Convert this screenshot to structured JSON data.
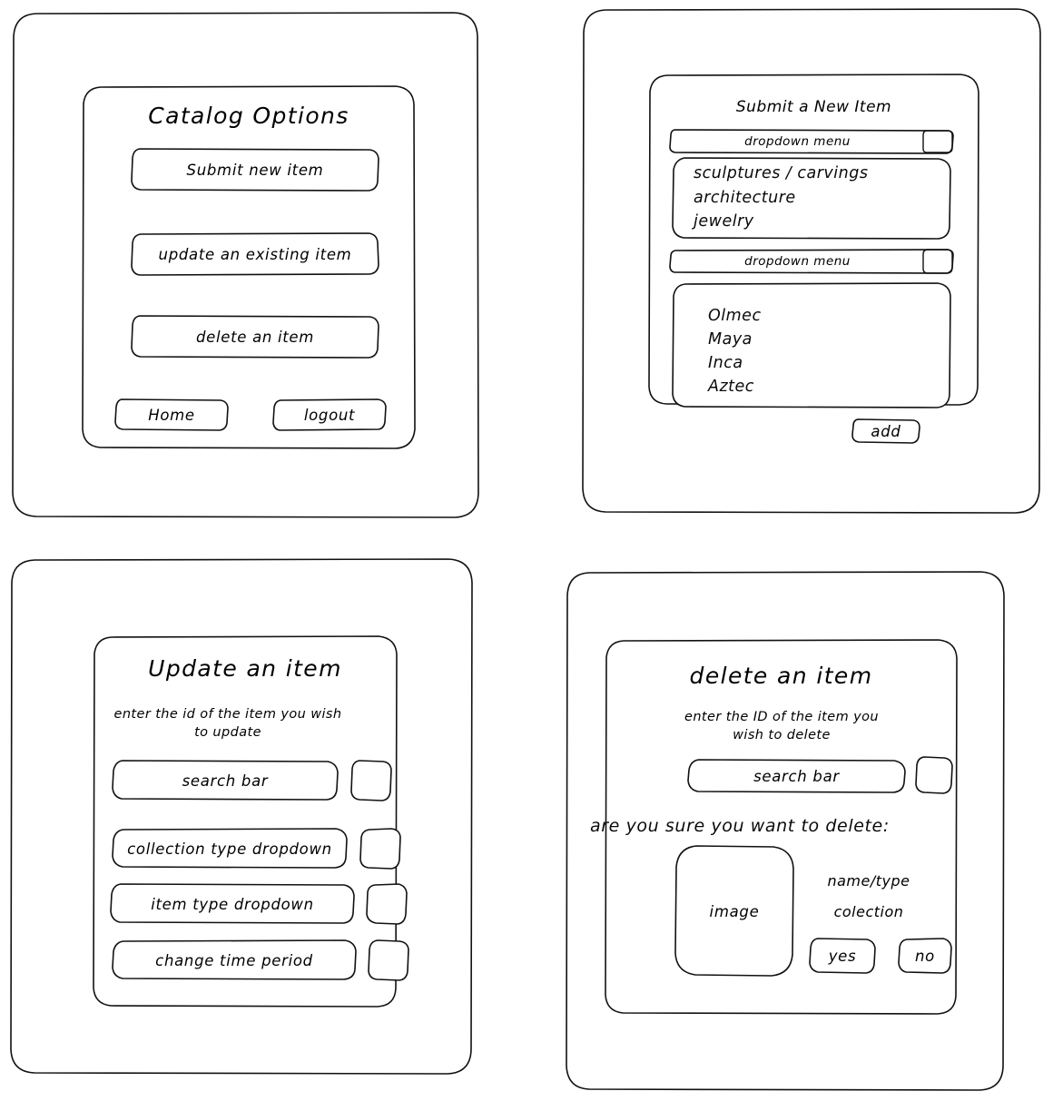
{
  "wireframe": {
    "stroke_color": "#111111",
    "background_color": "#ffffff",
    "panels": [
      {
        "id": "catalog-options",
        "title": "Catalog Options",
        "buttons": [
          {
            "label": "Submit new item"
          },
          {
            "label": "update an existing item"
          },
          {
            "label": "delete an item"
          }
        ],
        "footer_buttons": [
          {
            "label": "Home"
          },
          {
            "label": "logout"
          }
        ]
      },
      {
        "id": "submit-new-item",
        "title": "Submit a New Item",
        "dropdowns": [
          {
            "label": "dropdown menu",
            "options": [
              "sculptures / carvings",
              "architecture",
              "jewelry"
            ]
          },
          {
            "label": "dropdown menu",
            "options": [
              "Olmec",
              "Maya",
              "Inca",
              "Aztec"
            ]
          }
        ],
        "submit_button": {
          "label": "add"
        }
      },
      {
        "id": "update-an-item",
        "title": "Update an item",
        "helper_text": "enter the id of the item you wish to update",
        "fields": [
          {
            "label": "search bar"
          },
          {
            "label": "collection type dropdown"
          },
          {
            "label": "item type dropdown"
          },
          {
            "label": "change time period"
          }
        ]
      },
      {
        "id": "delete-an-item",
        "title": "delete an item",
        "helper_text": "enter the ID of the item you wish to delete",
        "search_field": {
          "label": "search bar"
        },
        "confirm_prompt": "are you sure you want to delete:",
        "image_placeholder": {
          "label": "image"
        },
        "item_meta": [
          "name/type",
          "colection"
        ],
        "confirm_buttons": [
          {
            "label": "yes"
          },
          {
            "label": "no"
          }
        ]
      }
    ]
  }
}
